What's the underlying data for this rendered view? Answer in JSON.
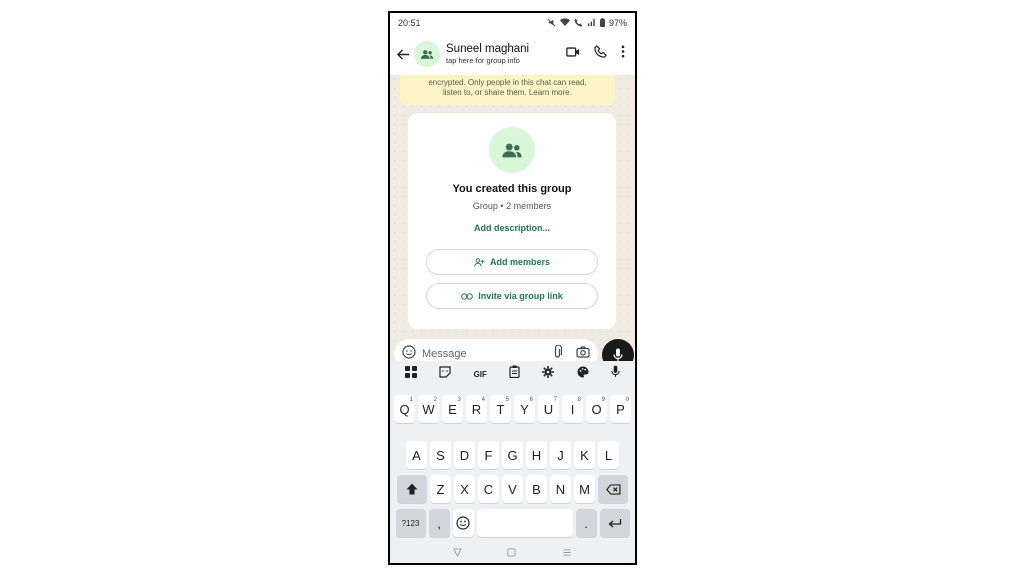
{
  "status": {
    "time": "20:51",
    "battery": "97%"
  },
  "header": {
    "name": "Suneel maghani",
    "subtitle": "tap here for group info"
  },
  "encryption": {
    "line1": "encrypted. Only people in this chat can read,",
    "line2": "listen to, or share them. Learn more."
  },
  "card": {
    "title": "You created this group",
    "meta": "Group • 2 members",
    "add_description": "Add description...",
    "add_members": "Add members",
    "invite_link": "Invite via group link"
  },
  "input": {
    "placeholder": "Message"
  },
  "keyboard": {
    "gif": "GIF",
    "row1": [
      {
        "k": "Q",
        "n": "1"
      },
      {
        "k": "W",
        "n": "2"
      },
      {
        "k": "E",
        "n": "3"
      },
      {
        "k": "R",
        "n": "4"
      },
      {
        "k": "T",
        "n": "5"
      },
      {
        "k": "Y",
        "n": "6"
      },
      {
        "k": "U",
        "n": "7"
      },
      {
        "k": "I",
        "n": "8"
      },
      {
        "k": "O",
        "n": "9"
      },
      {
        "k": "P",
        "n": "0"
      }
    ],
    "row2": [
      "A",
      "S",
      "D",
      "F",
      "G",
      "H",
      "J",
      "K",
      "L"
    ],
    "row3": [
      "Z",
      "X",
      "C",
      "V",
      "B",
      "N",
      "M"
    ],
    "symbols": "?123",
    "comma": ",",
    "period": "."
  },
  "colors": {
    "accent": "#1f7a4c",
    "avatar_bg": "#d9f7d6",
    "chat_bg": "#efeae2"
  }
}
